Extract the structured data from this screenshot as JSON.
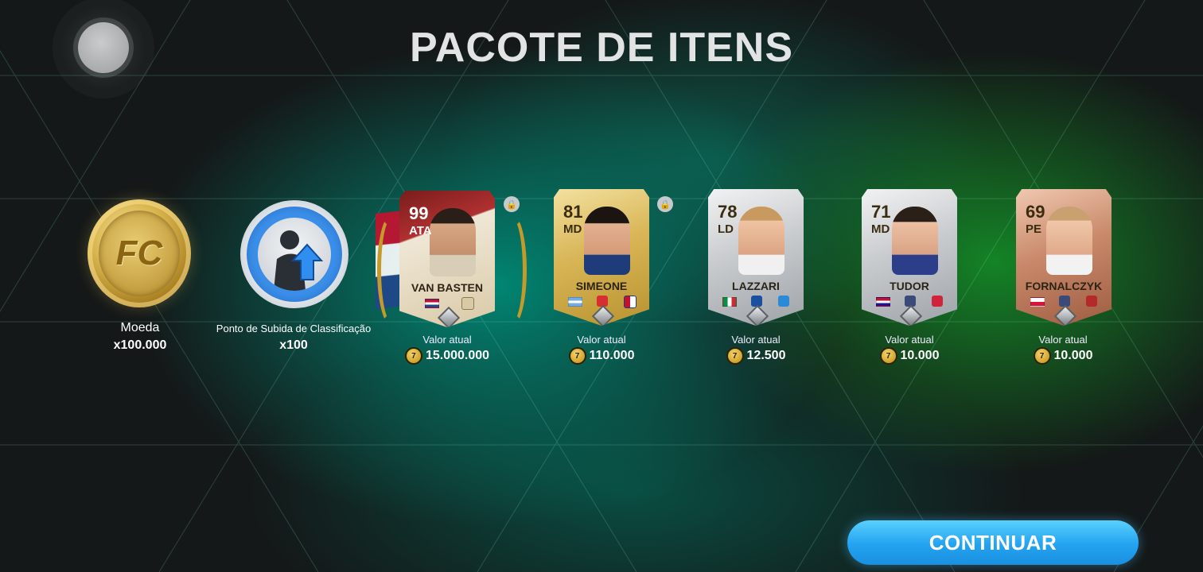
{
  "title": "PACOTE DE ITENS",
  "items": [
    {
      "label": "Moeda",
      "quantity": "x100.000",
      "icon": "ef-coin-icon"
    },
    {
      "label": "Ponto de Subida de Classificação",
      "quantity": "x100",
      "icon": "rank-up-point-icon"
    }
  ],
  "players": [
    {
      "name": "VAN BASTEN",
      "rating": "99",
      "position": "ATA",
      "tier": "icon",
      "value_label": "Valor atual",
      "value": "15.000.000",
      "locked": true
    },
    {
      "name": "SIMEONE",
      "rating": "81",
      "position": "MD",
      "tier": "gold",
      "value_label": "Valor atual",
      "value": "110.000",
      "locked": true
    },
    {
      "name": "LAZZARI",
      "rating": "78",
      "position": "LD",
      "tier": "silver",
      "value_label": "Valor atual",
      "value": "12.500",
      "locked": false
    },
    {
      "name": "TUDOR",
      "rating": "71",
      "position": "MD",
      "tier": "silver",
      "value_label": "Valor atual",
      "value": "10.000",
      "locked": false
    },
    {
      "name": "FORNALCZYK",
      "rating": "69",
      "position": "PE",
      "tier": "bronze",
      "value_label": "Valor atual",
      "value": "10.000",
      "locked": false
    }
  ],
  "continue_label": "CONTINUAR",
  "colors": {
    "accent": "#23a3f0",
    "gold": "#d8b556",
    "silver": "#c8cbce",
    "bronze": "#c9896a"
  }
}
